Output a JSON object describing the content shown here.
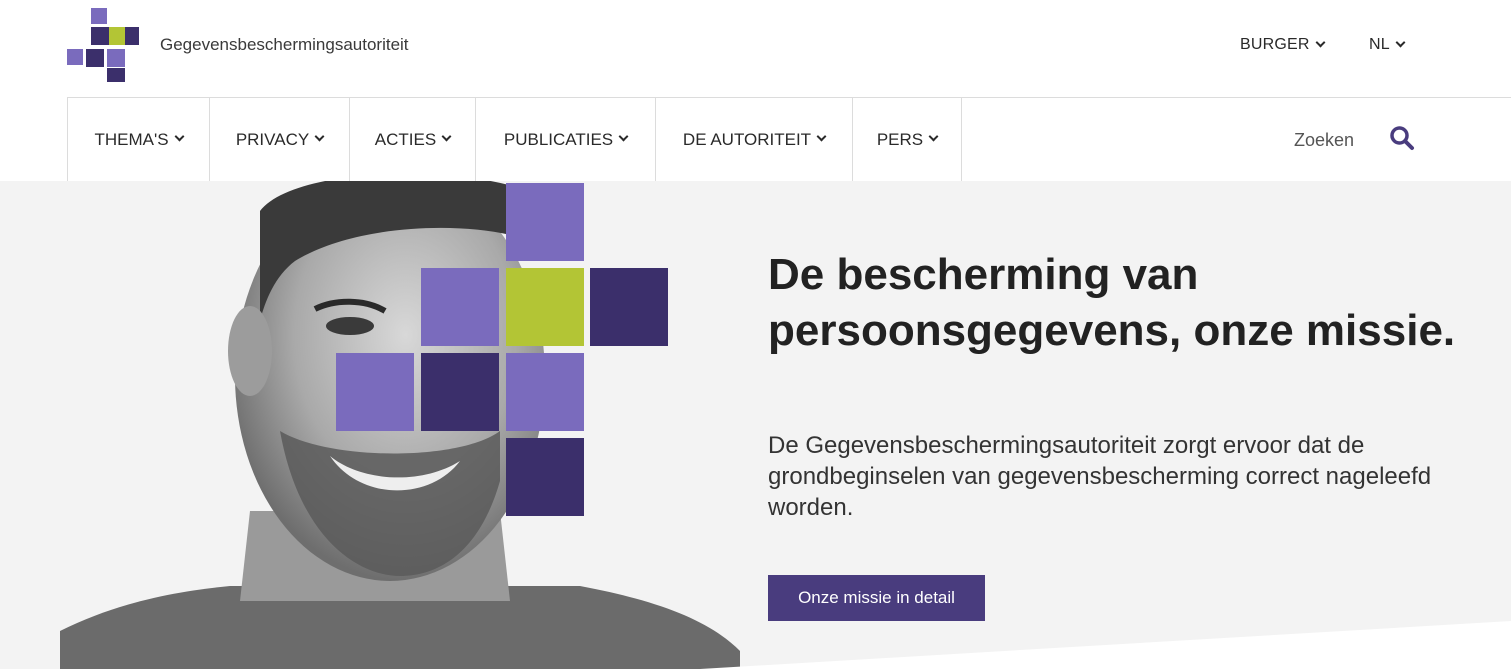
{
  "brand": {
    "name": "Gegevensbeschermingsautoriteit"
  },
  "top_menu": {
    "audience_label": "BURGER",
    "language_label": "NL"
  },
  "nav": {
    "items": [
      {
        "label": "THEMA'S"
      },
      {
        "label": "PRIVACY"
      },
      {
        "label": "ACTIES"
      },
      {
        "label": "PUBLICATIES"
      },
      {
        "label": "DE AUTORITEIT"
      },
      {
        "label": "PERS"
      }
    ],
    "search_label": "Zoeken",
    "search_icon": "search-icon"
  },
  "hero": {
    "headline_pre": "De ",
    "headline_bold": "bescherming van persoonsgegevens",
    "headline_post": ", onze missie.",
    "lead": "De Gegevensbeschermingsautoriteit zorgt ervoor dat de grondbeginselen van gegevensbescherming correct nageleefd worden.",
    "cta_label": "Onze missie in detail"
  },
  "colors": {
    "purple_light": "#7a6bbd",
    "purple_dark": "#3b2f6b",
    "lime": "#b3c535",
    "button": "#493c7e",
    "hero_bg": "#f3f3f3"
  }
}
